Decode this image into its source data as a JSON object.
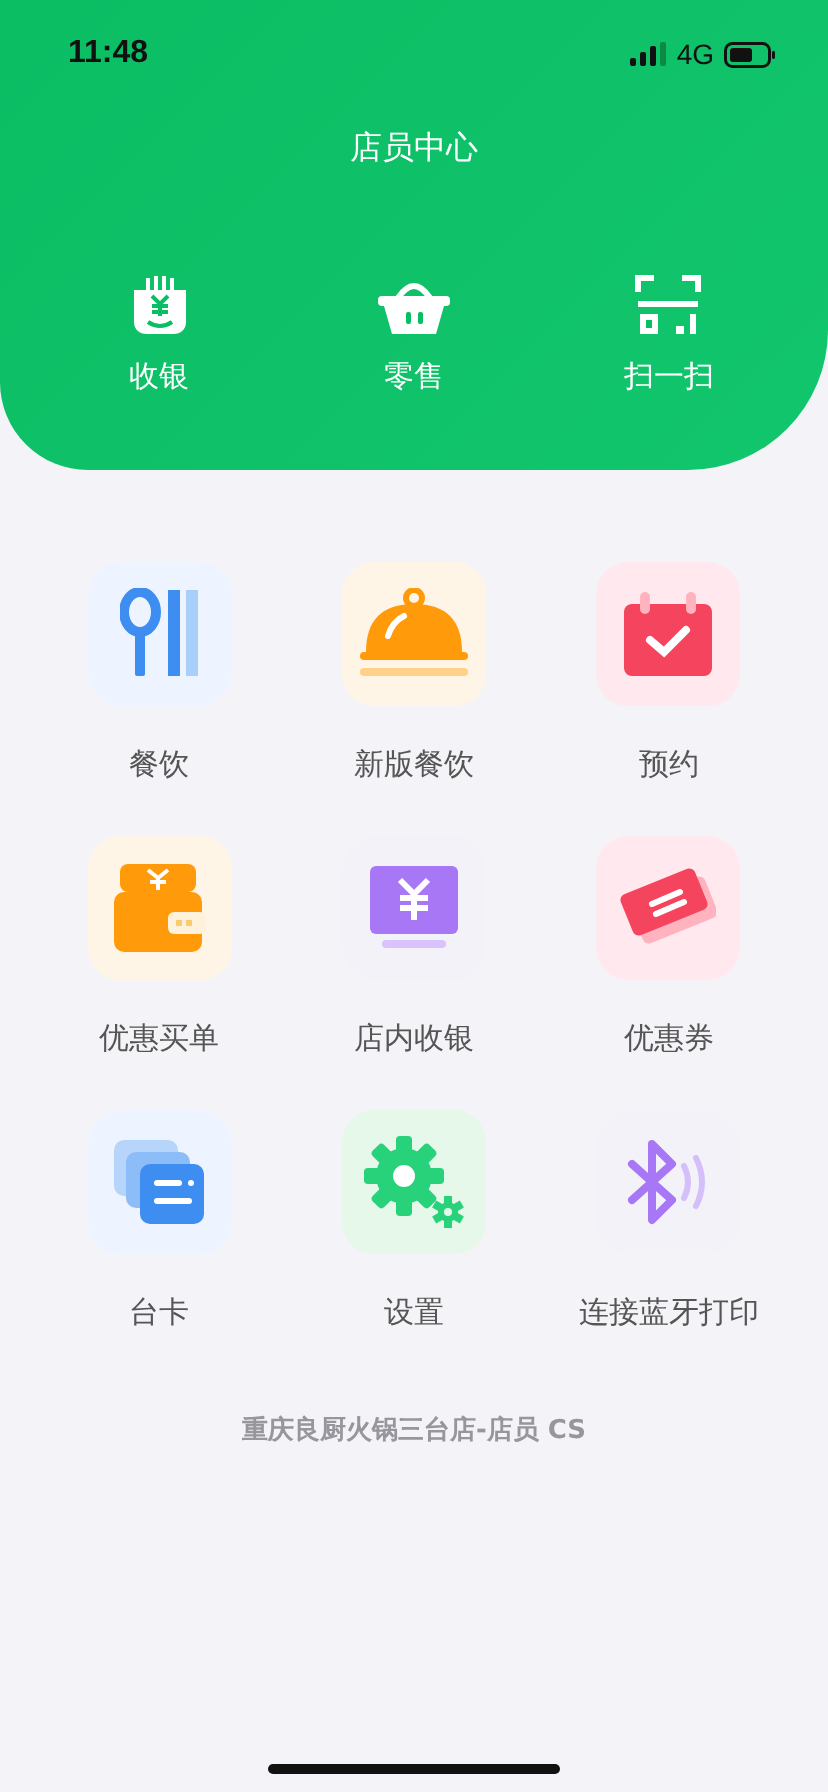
{
  "status_bar": {
    "time": "11:48",
    "network": "4G"
  },
  "header": {
    "title": "店员中心"
  },
  "quick_actions": [
    {
      "label": "收银"
    },
    {
      "label": "零售"
    },
    {
      "label": "扫一扫"
    }
  ],
  "menu": [
    {
      "label": "餐饮"
    },
    {
      "label": "新版餐饮"
    },
    {
      "label": "预约"
    },
    {
      "label": "优惠买单"
    },
    {
      "label": "店内收银"
    },
    {
      "label": "优惠券"
    },
    {
      "label": "台卡"
    },
    {
      "label": "设置"
    },
    {
      "label": "连接蓝牙打印"
    }
  ],
  "footer": {
    "text": "重庆良厨火锅三台店-店员 CS"
  }
}
